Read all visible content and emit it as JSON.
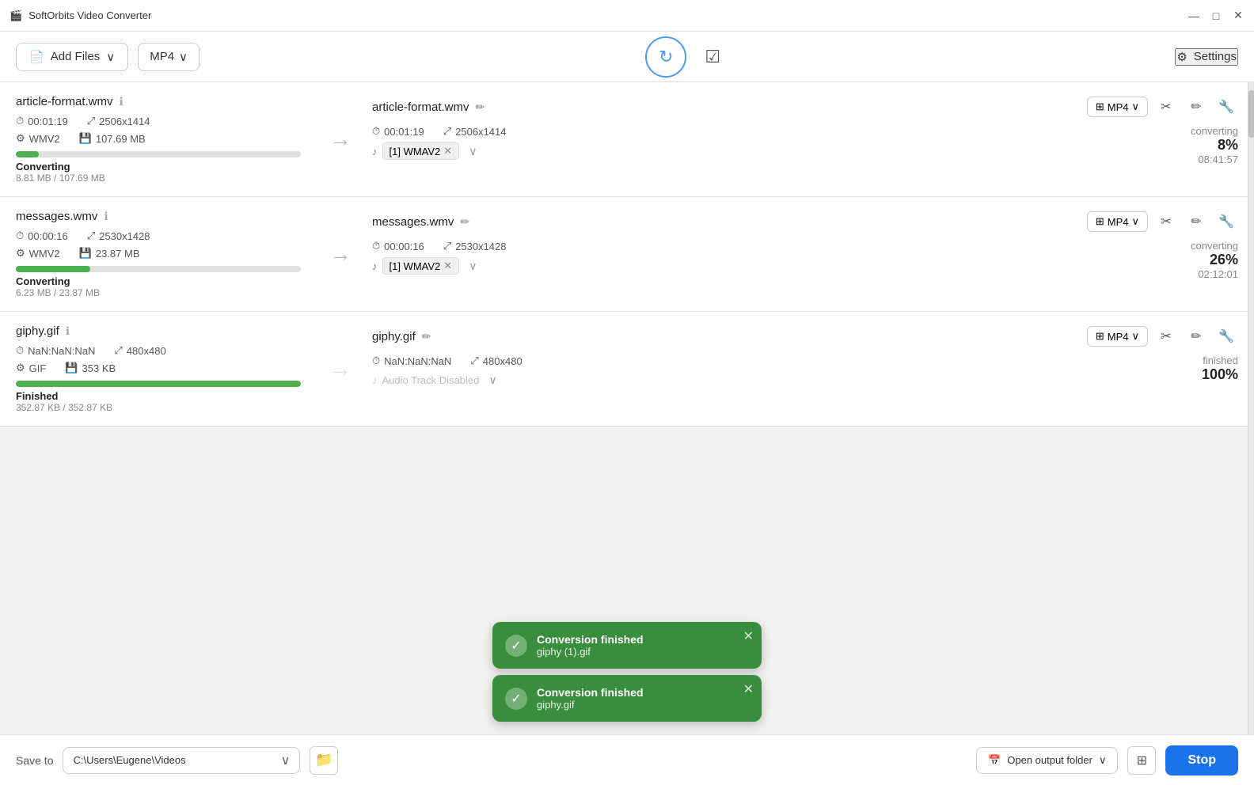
{
  "app": {
    "title": "SoftOrbits Video Converter",
    "icon": "🎬"
  },
  "titlebar": {
    "minimize_label": "—",
    "maximize_label": "□",
    "close_label": "✕"
  },
  "toolbar": {
    "add_files_label": "Add Files",
    "format_label": "MP4",
    "convert_icon": "↻",
    "check_icon": "☑",
    "settings_label": "Settings",
    "settings_icon": "⚙"
  },
  "files": [
    {
      "id": "file1",
      "input_name": "article-format.wmv",
      "input_duration": "00:01:19",
      "input_resolution": "2506x1414",
      "input_codec": "WMV2",
      "input_size": "107.69 MB",
      "output_name": "article-format.wmv",
      "output_duration": "00:01:19",
      "output_resolution": "2506x1414",
      "output_format": "MP4",
      "audio_track": "[1] WMAV2",
      "status": "converting",
      "progress_pct": 8,
      "progress_width": "8%",
      "progress_label": "Converting",
      "progress_size": "8.81 MB / 107.69 MB",
      "percent": "8%",
      "time_remaining": "08:41:57"
    },
    {
      "id": "file2",
      "input_name": "messages.wmv",
      "input_duration": "00:00:16",
      "input_resolution": "2530x1428",
      "input_codec": "WMV2",
      "input_size": "23.87 MB",
      "output_name": "messages.wmv",
      "output_duration": "00:00:16",
      "output_resolution": "2530x1428",
      "output_format": "MP4",
      "audio_track": "[1] WMAV2",
      "status": "converting",
      "progress_pct": 26,
      "progress_width": "26%",
      "progress_label": "Converting",
      "progress_size": "6.23 MB / 23.87 MB",
      "percent": "26%",
      "time_remaining": "02:12:01"
    },
    {
      "id": "file3",
      "input_name": "giphy.gif",
      "input_duration": "NaN:NaN:NaN",
      "input_resolution": "480x480",
      "input_codec": "GIF",
      "input_size": "353 KB",
      "output_name": "giphy.gif",
      "output_duration": "NaN:NaN:NaN",
      "output_resolution": "480x480",
      "output_format": "MP4",
      "audio_track": "Audio Track Disabled",
      "audio_disabled": true,
      "status": "finished",
      "progress_pct": 100,
      "progress_width": "100%",
      "progress_label": "Finished",
      "progress_size": "352.87 KB / 352.87 KB",
      "percent": "100%",
      "time_remaining": ""
    }
  ],
  "toasts": [
    {
      "id": "toast1",
      "title": "Conversion finished",
      "filename": "giphy (1).gif",
      "check": "✓"
    },
    {
      "id": "toast2",
      "title": "Conversion finished",
      "filename": "giphy.gif",
      "check": "✓"
    }
  ],
  "bottom_bar": {
    "save_to_label": "Save to",
    "path_value": "C:\\Users\\Eugene\\Videos",
    "open_folder_label": "Open output folder",
    "stop_label": "Stop"
  },
  "icons": {
    "arrow_right": "→",
    "clock": "⏱",
    "resize": "⤢",
    "codec": "⚙",
    "disk": "💾",
    "music": "♪",
    "info": "ℹ",
    "edit": "✏",
    "cut": "✂",
    "wrench": "🔧",
    "grid": "⊞",
    "folder": "📁",
    "calendar": "📅",
    "mp4_grid": "⊞",
    "dropdown": "∨"
  }
}
